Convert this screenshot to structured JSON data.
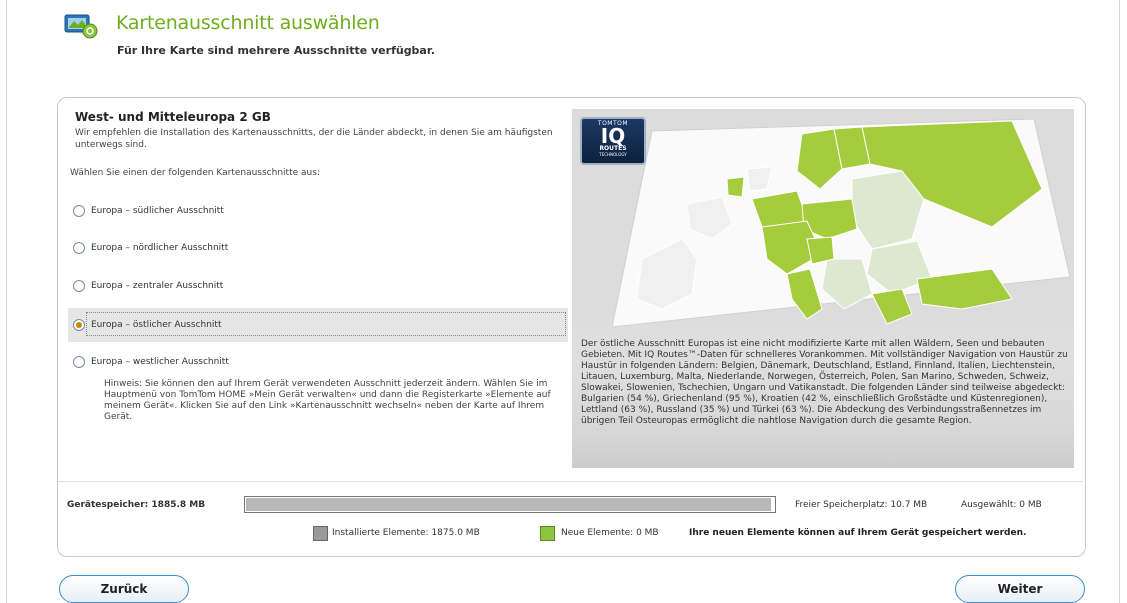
{
  "header": {
    "title": "Kartenausschnitt auswählen",
    "subtitle": "Für Ihre Karte sind mehrere Ausschnitte verfügbar."
  },
  "region": {
    "title": "West- und Mitteleuropa 2 GB",
    "description": "Wir empfehlen die Installation des Kartenausschnitts, der die Länder abdeckt, in denen Sie am häufigsten unterwegs sind.",
    "choose_label": "Wählen Sie einen der folgenden Kartenausschnitte aus:"
  },
  "options": [
    {
      "label": "Europa – südlicher Ausschnitt",
      "selected": false
    },
    {
      "label": "Europa – nördlicher Ausschnitt",
      "selected": false
    },
    {
      "label": "Europa – zentraler Ausschnitt",
      "selected": false
    },
    {
      "label": "Europa – östlicher Ausschnitt",
      "selected": true
    },
    {
      "label": "Europa – westlicher Ausschnitt",
      "selected": false
    }
  ],
  "hint": "Hinweis: Sie können den auf Ihrem Gerät verwendeten Ausschnitt jederzeit ändern. Wählen Sie im Hauptmenü von TomTom HOME »Mein Gerät verwalten« und dann die Registerkarte »Elemente auf meinem Gerät«. Klicken Sie auf den Link »Kartenausschnitt wechseln« neben der Karte auf Ihrem Gerät.",
  "map": {
    "badge_top": "TOMTOM",
    "badge_main": "IQ",
    "badge_routes": "ROUTES",
    "badge_tech": "TECHNOLOGY",
    "description": "Der östliche Ausschnitt Europas ist eine nicht modifizierte Karte mit allen Wäldern, Seen und bebauten Gebieten. Mit IQ Routes™-Daten für schnelleres Vorankommen. Mit vollständiger Navigation von Haustür zu Haustür in folgenden Ländern: Belgien, Dänemark, Deutschland, Estland, Finnland, Italien, Liechtenstein, Litauen, Luxemburg, Malta, Niederlande, Norwegen, Österreich, Polen, San Marino, Schweden, Schweiz, Slowakei, Slowenien, Tschechien, Ungarn und Vatikanstadt. Die folgenden Länder sind teilweise abgedeckt: Bulgarien (54 %), Griechenland (95 %), Kroatien (42 %, einschließlich Großstädte und Küstenregionen), Lettland (63 %), Russland (35 %) und Türkei (63 %). Die Abdeckung des Verbindungsstraßennetzes im übrigen Teil Osteuropas ermöglicht die nahtlose Navigation durch die gesamte Region.",
    "colors": {
      "covered": "#a4cc3c",
      "partial": "#dde8d0",
      "other": "#f0f0f0",
      "border": "#ffffff"
    }
  },
  "storage": {
    "device_label": "Gerätespeicher:  1885.8 MB",
    "used_fraction": 0.994,
    "free_label": "Freier Speicherplatz:  10.7 MB",
    "selected_label": "Ausgewählt:        0 MB",
    "installed_label": "Installierte Elemente: 1875.0 MB",
    "new_label": "Neue Elemente: 0 MB",
    "save_note": "Ihre neuen Elemente können auf Ihrem Gerät gespeichert werden."
  },
  "buttons": {
    "back": "Zurück",
    "next": "Weiter"
  },
  "colors": {
    "accent": "#6fae1e",
    "button_border": "#3b8fd0"
  }
}
